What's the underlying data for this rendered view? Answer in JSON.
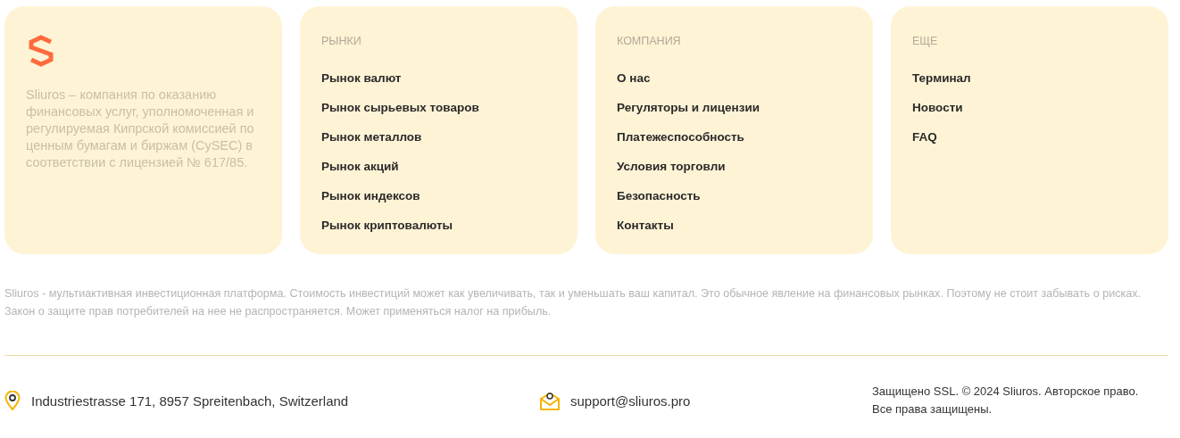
{
  "about": {
    "text": "Sliuros – компания по оказанию финансовых услуг, уполномоченная и регулируемая Кипрской комиссией по ценным бумагам и биржам (CySEC) в соответствии с лицензией № 617/85."
  },
  "columns": [
    {
      "title": "РЫНКИ",
      "links": [
        "Рынок валют",
        "Рынок сырьевых товаров",
        "Рынок металлов",
        "Рынок акций",
        "Рынок индексов",
        "Рынок криптовалюты"
      ]
    },
    {
      "title": "КОМПАНИЯ",
      "links": [
        "О нас",
        "Регуляторы и лицензии",
        "Платежеспособность",
        "Условия торговли",
        "Безопасность",
        "Контакты"
      ]
    },
    {
      "title": "ЕЩЕ",
      "links": [
        "Терминал",
        "Новости",
        "FAQ"
      ]
    }
  ],
  "disclaimer": "Sliuros - мультиактивная инвестиционная платформа. Стоимость инвестиций может как увеличивать, так и уменьшать ваш капитал. Это обычное явление на финансовых рынках. Поэтому не стоит забывать о рисках. Закон о защите прав потребителей на нее не распространяется. Может применяться налог на прибыль.",
  "contacts": [
    {
      "kind": "address",
      "text": "Industriestrasse 171, 8957 Spreitenbach, Switzerland"
    },
    {
      "kind": "email",
      "text": "support@sliuros.pro"
    }
  ],
  "copyright": "Защищено SSL. © 2024 Sliuros. Авторское право. Все права защищены."
}
